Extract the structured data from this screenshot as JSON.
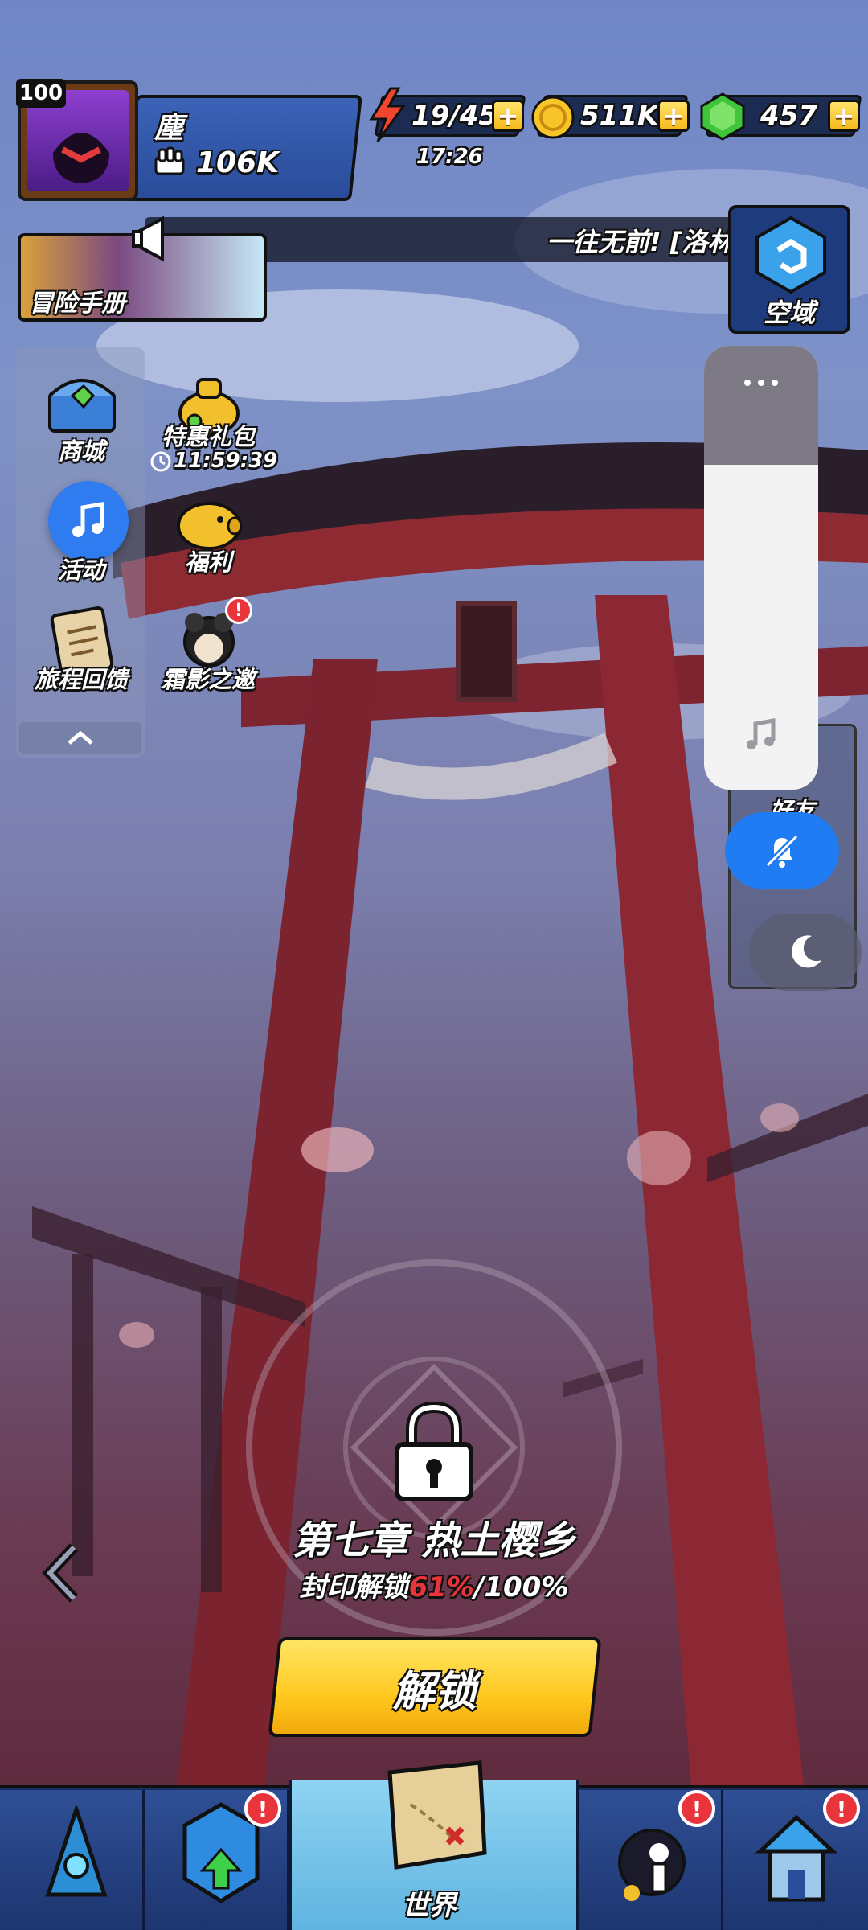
{
  "profile": {
    "level": "100",
    "name": "塵",
    "power": "106K"
  },
  "resources": {
    "energy": "19/45",
    "energy_timer": "17:26",
    "gold": "511K",
    "gems": "457",
    "plus": "+"
  },
  "marquee": {
    "text": "一往无前! [洛林"
  },
  "adventure_manual": {
    "label": "冒险手册"
  },
  "sky_domain": {
    "label": "空域"
  },
  "left_menu": {
    "items": [
      {
        "label": "商城"
      },
      {
        "label": "特惠礼包",
        "timer": "11:59:39"
      },
      {
        "label": "活动"
      },
      {
        "label": "福利"
      },
      {
        "label": "旅程回馈"
      },
      {
        "label": "霜影之邀"
      }
    ]
  },
  "right_menu": {
    "friends_label": "好友"
  },
  "chapter": {
    "title": "第七章 热土樱乡",
    "seal_prefix": "封印解锁",
    "seal_progress": "61%",
    "seal_total": "/100%",
    "unlock_label": "解锁"
  },
  "bottom_nav": {
    "world_label": "世界",
    "alert": "!"
  },
  "colors": {
    "accent_blue": "#1f7cf2",
    "gold_button": "#ffc81e",
    "alert_red": "#e8343a",
    "torii_red": "#9b2b34"
  }
}
